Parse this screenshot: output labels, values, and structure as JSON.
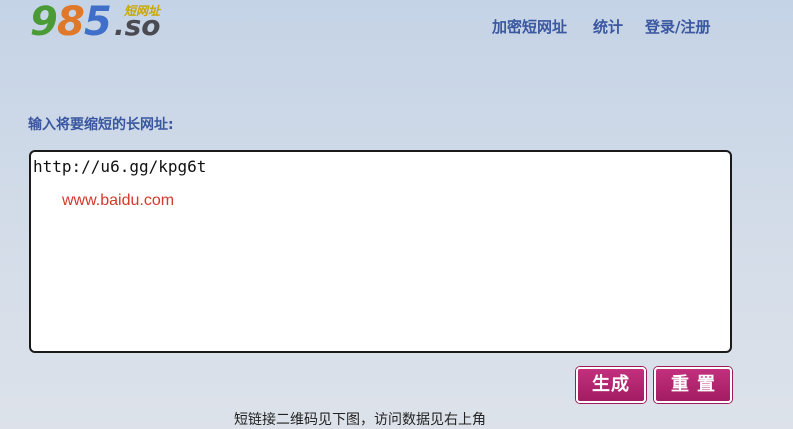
{
  "logo": {
    "digits": [
      "9",
      "8",
      "5"
    ],
    "digit_colors": [
      "#4a9a36",
      "#e0782a",
      "#3f6fc8"
    ],
    "suffix": ".so",
    "tagline": "短网址"
  },
  "nav": {
    "items": [
      {
        "label": "加密短网址"
      },
      {
        "label": "统计"
      },
      {
        "label": "登录/注册"
      }
    ]
  },
  "form": {
    "prompt_label": "输入将要缩短的长网址:",
    "textarea_value": "http://u6.gg/kpg6t",
    "original_url": "www.baidu.com"
  },
  "buttons": {
    "generate": "生成",
    "reset": "重置"
  },
  "footer": {
    "note": "短链接二维码见下图，访问数据见右上角"
  },
  "colors": {
    "nav_text": "#3a57a0",
    "button_bg": "#b0246d",
    "original_url_text": "#d23a2a"
  }
}
